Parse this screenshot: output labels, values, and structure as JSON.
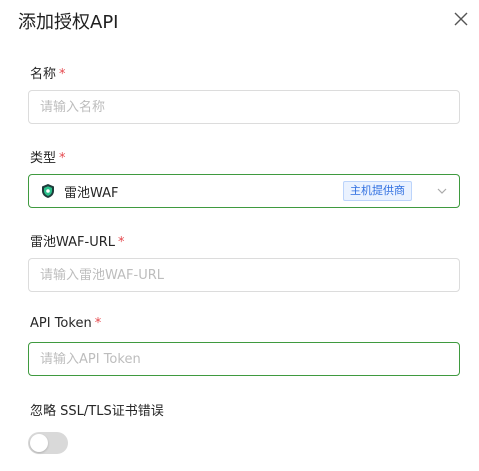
{
  "dialog": {
    "title": "添加授权API"
  },
  "form": {
    "name": {
      "label": "名称",
      "required_mark": "*",
      "placeholder": "请输入名称",
      "value": ""
    },
    "type": {
      "label": "类型",
      "required_mark": "*",
      "selected": "雷池WAF",
      "badge": "主机提供商",
      "icon": "safeline-shield-icon"
    },
    "waf_url": {
      "label": "雷池WAF-URL",
      "required_mark": "*",
      "placeholder": "请输入雷池WAF-URL",
      "value": ""
    },
    "api_token": {
      "label": "API Token",
      "required_mark": "*",
      "placeholder": "请输入API Token",
      "value": ""
    },
    "ignore_ssl": {
      "label": "忽略 SSL/TLS证书错误",
      "enabled": false
    }
  },
  "colors": {
    "accent": "#3f9a3f",
    "required": "#e5484d",
    "badge_text": "#2f6fe0",
    "badge_bg": "#eaf2ff"
  }
}
